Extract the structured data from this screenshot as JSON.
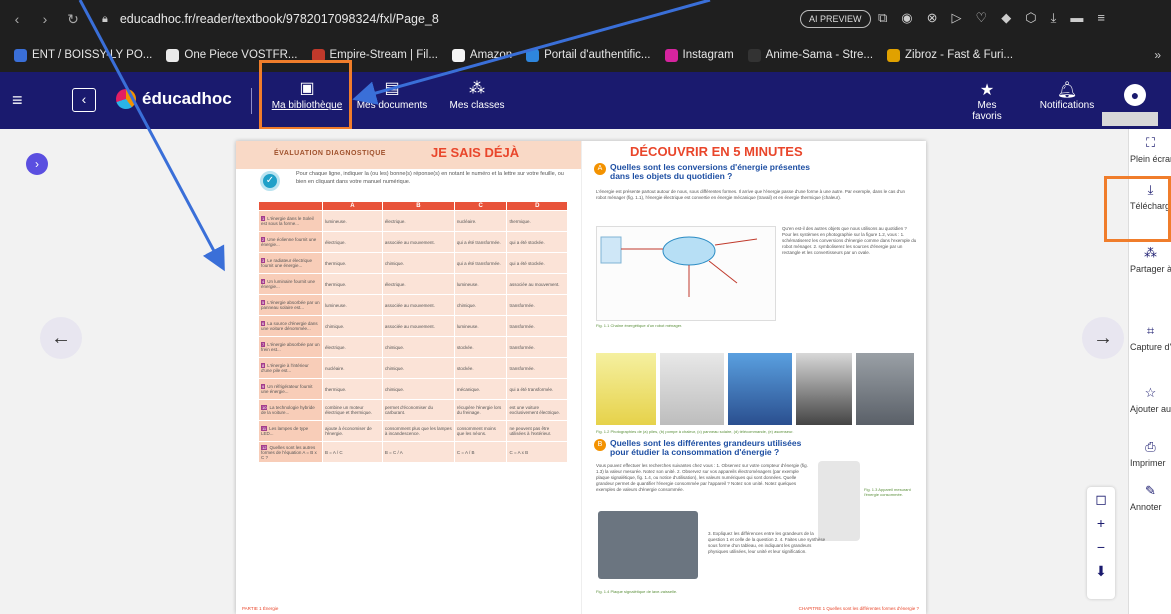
{
  "browser": {
    "url": "educadhoc.fr/reader/textbook/9782017098324/fxl/Page_8",
    "ai_badge": "AI PREVIEW",
    "bookmarks": [
      {
        "label": "ENT / BOISSY-LY PO...",
        "color": "#3a6fd8"
      },
      {
        "label": "One Piece VOSTFR...",
        "color": "#eaeaea"
      },
      {
        "label": "Empire-Stream | Fil...",
        "color": "#c0392b"
      },
      {
        "label": "Amazon",
        "color": "#f5f5f5"
      },
      {
        "label": "Portail d'authentific...",
        "color": "#2e86de"
      },
      {
        "label": "Instagram",
        "color": "#d6249f"
      },
      {
        "label": "Anime-Sama - Stre...",
        "color": "#333333"
      },
      {
        "label": "Zibroz - Fast & Furi...",
        "color": "#e0a100"
      }
    ],
    "more": "»"
  },
  "app": {
    "logo": "éducadhoc",
    "nav": {
      "library": "Ma bibliothèque",
      "documents": "Mes documents",
      "classes": "Mes classes"
    },
    "right": {
      "favorites": "Mes favoris",
      "notifications": "Notifications"
    }
  },
  "left_page": {
    "diag_label": "ÉVALUATION DIAGNOSTIQUE",
    "title": "JE SAIS DÉJÀ",
    "instructions": "Pour chaque ligne, indiquer la (ou les) bonne(s) réponse(s) en notant le numéro et la lettre sur votre feuille, ou bien en cliquant dans votre manuel numérique.",
    "columns": [
      "A",
      "B",
      "C",
      "D"
    ],
    "rows": [
      {
        "n": "1",
        "q": "L'énergie dans le Soleil est sous la forme...",
        "a": [
          "lumineuse.",
          "électrique.",
          "nucléaire.",
          "thermique."
        ]
      },
      {
        "n": "2",
        "q": "Une éolienne fournit une énergie...",
        "a": [
          "électrique.",
          "associée au mouvement.",
          "qui a été transformée.",
          "qui a été stockée."
        ]
      },
      {
        "n": "3",
        "q": "Le radiateur électrique fournit une énergie...",
        "a": [
          "thermique.",
          "chimique.",
          "qui a été transformée.",
          "qui a été stockée."
        ]
      },
      {
        "n": "4",
        "q": "Un luminaire fournit une énergie...",
        "a": [
          "thermique.",
          "électrique.",
          "lumineuse.",
          "associée au mouvement."
        ]
      },
      {
        "n": "5",
        "q": "L'énergie absorbée par un panneau solaire est...",
        "a": [
          "lumineuse.",
          "associée au mouvement.",
          "chimique.",
          "transformée."
        ]
      },
      {
        "n": "6",
        "q": "La source d'énergie dans une voiture dénommée...",
        "a": [
          "chimique.",
          "associée au mouvement.",
          "lumineuse.",
          "transformée."
        ]
      },
      {
        "n": "7",
        "q": "L'énergie absorbée par un frein est...",
        "a": [
          "électrique.",
          "chimique.",
          "stockée.",
          "transformée."
        ]
      },
      {
        "n": "8",
        "q": "L'énergie à l'intérieur d'une pile est...",
        "a": [
          "nucléaire.",
          "chimique.",
          "stockée.",
          "transformée."
        ]
      },
      {
        "n": "9",
        "q": "Un réfrigérateur fournit une énergie...",
        "a": [
          "thermique.",
          "chimique.",
          "mécanique.",
          "qui a été transformée."
        ]
      },
      {
        "n": "10",
        "q": "La technologie hybride de la voiture...",
        "a": [
          "combine un moteur électrique et thermique.",
          "permet d'économiser du carburant.",
          "récupère l'énergie lors du freinage.",
          "est une voiture exclusivement électrique."
        ]
      },
      {
        "n": "11",
        "q": "Les lampes de type LED...",
        "a": [
          "ajoute à économiser de l'énergie.",
          "consomment plus que les lampes à incandescence.",
          "consomment moins que les néons.",
          "ne peuvent pas être utilisées à l'extérieur."
        ]
      },
      {
        "n": "12",
        "q": "Quelles sont les autres formes de l'équation A = B x C ?",
        "a": [
          "B = A / C",
          "B = C / A",
          "C = A / B",
          "C = A x B"
        ]
      }
    ],
    "footer": "PARTIE 1 Énergie"
  },
  "right_page": {
    "title": "DÉCOUVRIR EN 5 MINUTES",
    "sec_a_badge": "A",
    "sec_a_title": "Quelles sont les conversions d'énergie présentes dans les objets du quotidien ?",
    "sec_a_text": "L'énergie est présente partout autour de nous, sous différentes formes. Il arrive que l'énergie passe d'une forme à une autre. Par exemple, dans le cas d'un robot ménager (fig. 1.1), l'énergie électrique est convertie en énergie mécanique (travail) et en énergie thermique (chaleur).",
    "sec_a_side": "Qu'en est-il des autres objets que nous utilisons au quotidien ? Pour les systèmes en photographie sur la figure 1.2, vous : 1. schématiserez les conversions d'énergie comme dans l'exemple du robot ménager. 2. symboliserez les sources d'énergie par un rectangle et les convertisseurs par un ovale.",
    "fig1_caption": "Fig. 1.1 Chaîne énergétique d'un robot ménager.",
    "fig2_caption": "Fig. 1.2 Photographies de (a) piles, (b) pompe à chaleur, (c) panneau solaire, (d) télécommande, (e) ascenseur.",
    "sec_b_badge": "B",
    "sec_b_title": "Quelles sont les différentes grandeurs utilisées pour étudier la consommation d'énergie ?",
    "sec_b_text": "Vous pouvez effectuer les recherches suivantes chez vous : 1. Observez sur votre compteur d'énergie (fig. 1.3) la valeur mesurée. Notez son unité. 2. Observez sur vos appareils électroménagers (par exemple plaque signalétique, fig. 1.4, ou notice d'utilisation), les valeurs numériques qui sont données. Quelle grandeur permet de quantifier l'énergie consommée par l'appareil ? Notez son unité. Notez quelques exemples de valeurs d'énergie consommée.",
    "sec_b_side": "3. Expliquez les différences entre les grandeurs de la question 1 et celle de la question 2. 4. Faites une synthèse sous forme d'un tableau, en indiquant les grandeurs physiques utilisées, leur unité et leur signification.",
    "fig3_caption": "Fig. 1.3 Appareil mesurant l'énergie consommée.",
    "fig4_caption": "Fig. 1.4 Plaque signalétique de lave-vaisselle.",
    "footer": "CHAPITRE 1 Quelles sont les différentes formes d'énergie ?"
  },
  "tools": [
    {
      "icon": "fullscreen-icon",
      "glyph": "⛶",
      "label": "Plein écran"
    },
    {
      "icon": "download-icon",
      "glyph": "⤓",
      "label": "Télécharger le manuel"
    },
    {
      "icon": "share-icon",
      "glyph": "⁂",
      "label": "Partager à mon professeur"
    },
    {
      "icon": "screenshot-icon",
      "glyph": "⌗",
      "label": "Capture d'écran"
    },
    {
      "icon": "star-outline-icon",
      "glyph": "☆",
      "label": "Ajouter aux favoris"
    },
    {
      "icon": "print-icon",
      "glyph": "⎙",
      "label": "Imprimer"
    },
    {
      "icon": "annotate-icon",
      "glyph": "✎",
      "label": "Annoter"
    }
  ],
  "colors": {
    "appbar": "#1a1a6e",
    "highlight": "#f07d2b",
    "annotation_arrow": "#3a6fd8"
  }
}
